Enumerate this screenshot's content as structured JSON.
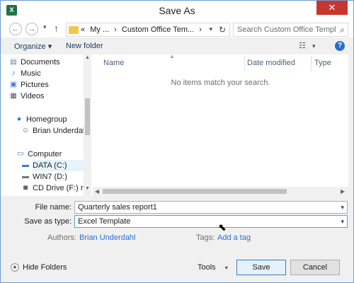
{
  "window": {
    "title": "Save As",
    "app_icon_letter": "X",
    "close_glyph": "✕"
  },
  "nav": {
    "back_glyph": "←",
    "forward_glyph": "→",
    "history_glyph": "▾",
    "up_glyph": "↑",
    "breadcrumb": [
      "«",
      "My ...",
      "›",
      "Custom Office Tem...",
      "›"
    ],
    "address_dropdown_glyph": "▾",
    "refresh_glyph": "↻",
    "search_placeholder": "Search Custom Office Templa...",
    "search_glyph": "⌕"
  },
  "toolbar": {
    "organize_label": "Organize ▾",
    "new_folder_label": "New folder",
    "view_glyph": "☷",
    "view_dropdown_glyph": "▾",
    "help_glyph": "?"
  },
  "sidebar": {
    "items": [
      {
        "label": "Documents",
        "icon": "documents-icon",
        "glyph": "▤"
      },
      {
        "label": "Music",
        "icon": "music-icon",
        "glyph": "♪"
      },
      {
        "label": "Pictures",
        "icon": "pictures-icon",
        "glyph": "▣"
      },
      {
        "label": "Videos",
        "icon": "videos-icon",
        "glyph": "▦"
      },
      {
        "label": "Homegroup",
        "icon": "homegroup-icon",
        "glyph": "●"
      },
      {
        "label": "Brian Underdahl",
        "icon": "user-icon",
        "glyph": "☺"
      },
      {
        "label": "Computer",
        "icon": "computer-icon",
        "glyph": "▭"
      },
      {
        "label": "DATA (C:)",
        "icon": "drive-icon",
        "glyph": "▬"
      },
      {
        "label": "WIN7 (D:)",
        "icon": "drive-icon",
        "glyph": "▬"
      },
      {
        "label": "CD Drive (F:) mag",
        "icon": "cd-drive-icon",
        "glyph": "◙"
      }
    ]
  },
  "files": {
    "columns": [
      "Name",
      "Date modified",
      "Type"
    ],
    "empty_message": "No items match your search.",
    "sort_glyph": "▲"
  },
  "form": {
    "file_name_label": "File name:",
    "file_name_value": "Quarterly sales report1",
    "save_type_label": "Save as type:",
    "save_type_value": "Excel Template",
    "dropdown_glyph": "▾",
    "authors_label": "Authors:",
    "authors_value": "Brian Underdahl",
    "tags_label": "Tags:",
    "tags_value": "Add a tag"
  },
  "footer": {
    "hide_folders_label": "Hide Folders",
    "hide_folders_glyph": "▲",
    "tools_label": "Tools",
    "tools_dropdown_glyph": "▾",
    "save_label": "Save",
    "cancel_label": "Cancel"
  },
  "cursor_glyph": "⬉"
}
